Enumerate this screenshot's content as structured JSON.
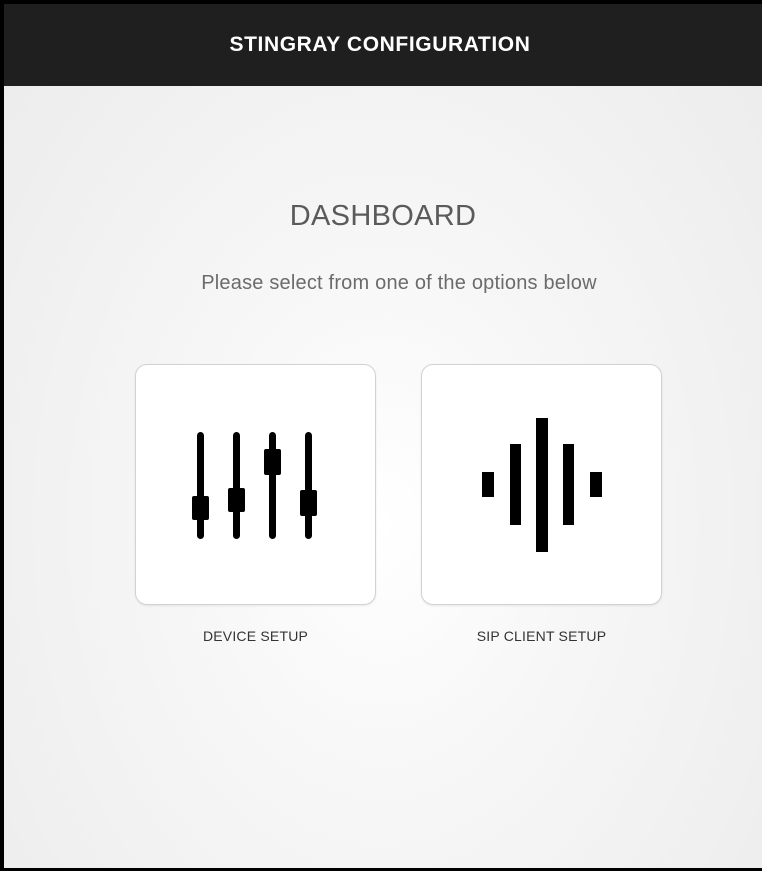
{
  "header": {
    "title": "STINGRAY CONFIGURATION"
  },
  "main": {
    "title": "DASHBOARD",
    "subtitle": "Please select from one of the options below"
  },
  "options": [
    {
      "label": "DEVICE SETUP",
      "icon": "sliders-icon"
    },
    {
      "label": "SIP CLIENT SETUP",
      "icon": "sound-wave-icon"
    }
  ],
  "colors": {
    "header_bg": "#1f1f1f",
    "header_text": "#ffffff",
    "icon": "#000000",
    "tile_bg": "#ffffff"
  }
}
